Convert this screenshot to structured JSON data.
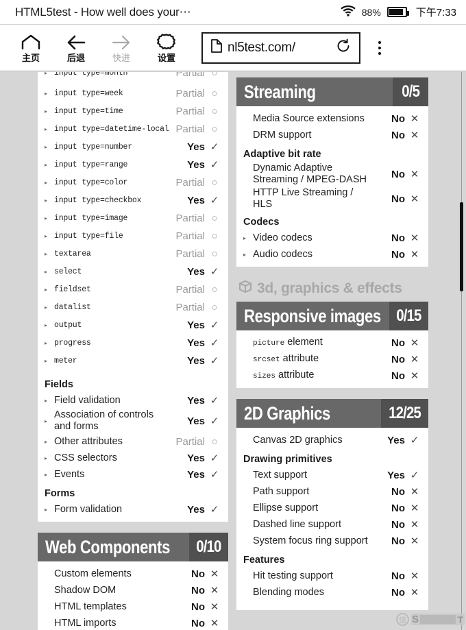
{
  "statusbar": {
    "title": "HTML5test - How well does your⋯",
    "wifi_icon": "wifi-icon",
    "battery_percent": "88%",
    "clock": "下午7:33"
  },
  "toolbar": {
    "home_label": "主页",
    "back_label": "后退",
    "forward_label": "快进",
    "settings_label": "设置",
    "url": "nl5test.com/",
    "reload_icon": "reload-icon",
    "page-icon": "page-icon",
    "menu_icon": "overflow-menu-icon"
  },
  "left_column": {
    "clipped_row": {
      "label": "input type=month",
      "value": "Partial",
      "state": "partial"
    },
    "form_rows": [
      {
        "label": "input type=week",
        "value": "Partial",
        "state": "partial"
      },
      {
        "label": "input type=time",
        "value": "Partial",
        "state": "partial"
      },
      {
        "label": "input type=datetime-local",
        "value": "Partial",
        "state": "partial"
      },
      {
        "label": "input type=number",
        "value": "Yes",
        "state": "yes"
      },
      {
        "label": "input type=range",
        "value": "Yes",
        "state": "yes"
      },
      {
        "label": "input type=color",
        "value": "Partial",
        "state": "partial"
      },
      {
        "label": "input type=checkbox",
        "value": "Yes",
        "state": "yes"
      },
      {
        "label": "input type=image",
        "value": "Partial",
        "state": "partial"
      },
      {
        "label": "input type=file",
        "value": "Partial",
        "state": "partial"
      },
      {
        "label": "textarea",
        "value": "Partial",
        "state": "partial"
      },
      {
        "label": "select",
        "value": "Yes",
        "state": "yes"
      },
      {
        "label": "fieldset",
        "value": "Partial",
        "state": "partial"
      },
      {
        "label": "datalist",
        "value": "Partial",
        "state": "partial"
      },
      {
        "label": "output",
        "value": "Yes",
        "state": "yes"
      },
      {
        "label": "progress",
        "value": "Yes",
        "state": "yes"
      },
      {
        "label": "meter",
        "value": "Yes",
        "state": "yes"
      }
    ],
    "fields_heading": "Fields",
    "fields_rows": [
      {
        "label": "Field validation",
        "value": "Yes",
        "state": "yes"
      },
      {
        "label": "Association of controls and forms",
        "value": "Yes",
        "state": "yes"
      },
      {
        "label": "Other attributes",
        "value": "Partial",
        "state": "partial"
      },
      {
        "label": "CSS selectors",
        "value": "Yes",
        "state": "yes"
      },
      {
        "label": "Events",
        "value": "Yes",
        "state": "yes"
      }
    ],
    "forms_heading": "Forms",
    "forms_rows": [
      {
        "label": "Form validation",
        "value": "Yes",
        "state": "yes"
      }
    ],
    "web_components": {
      "title": "Web Components",
      "score": "0/10",
      "rows": [
        {
          "label": "Custom elements",
          "value": "No",
          "state": "no"
        },
        {
          "label": "Shadow DOM",
          "value": "No",
          "state": "no"
        },
        {
          "label": "HTML templates",
          "value": "No",
          "state": "no"
        },
        {
          "label": "HTML imports",
          "value": "No",
          "state": "no"
        }
      ]
    }
  },
  "right_column": {
    "streaming": {
      "title": "Streaming",
      "score": "0/5",
      "rows": [
        {
          "label": "Media Source extensions",
          "value": "No",
          "state": "no"
        },
        {
          "label": "DRM support",
          "value": "No",
          "state": "no"
        }
      ],
      "adaptive_heading": "Adaptive bit rate",
      "adaptive_rows": [
        {
          "label": "Dynamic Adaptive Streaming / MPEG-DASH",
          "value": "No",
          "state": "no"
        },
        {
          "label": "HTTP Live Streaming / HLS",
          "value": "No",
          "state": "no"
        }
      ],
      "codecs_heading": "Codecs",
      "codec_rows": [
        {
          "label": "Video codecs",
          "value": "No",
          "state": "no"
        },
        {
          "label": "Audio codecs",
          "value": "No",
          "state": "no"
        }
      ]
    },
    "graphics_group": {
      "title": "3d, graphics & effects",
      "icon": "cube-icon"
    },
    "responsive_images": {
      "title": "Responsive images",
      "score": "0/15",
      "rows": [
        {
          "mono": "picture",
          "rest": " element",
          "value": "No",
          "state": "no"
        },
        {
          "mono": "srcset",
          "rest": " attribute",
          "value": "No",
          "state": "no"
        },
        {
          "mono": "sizes",
          "rest": " attribute",
          "value": "No",
          "state": "no"
        }
      ]
    },
    "graphics_2d": {
      "title": "2D Graphics",
      "score": "12/25",
      "rows": [
        {
          "label": "Canvas 2D graphics",
          "value": "Yes",
          "state": "yes"
        }
      ],
      "primitives_heading": "Drawing primitives",
      "primitives_rows": [
        {
          "label": "Text support",
          "value": "Yes",
          "state": "yes"
        },
        {
          "label": "Path support",
          "value": "No",
          "state": "no"
        },
        {
          "label": "Ellipse support",
          "value": "No",
          "state": "no"
        },
        {
          "label": "Dashed line support",
          "value": "No",
          "state": "no"
        },
        {
          "label": "System focus ring support",
          "value": "No",
          "state": "no"
        }
      ],
      "features_heading": "Features",
      "features_rows": [
        {
          "label": "Hit testing support",
          "value": "No",
          "state": "no"
        },
        {
          "label": "Blending modes",
          "value": "No",
          "state": "no"
        }
      ]
    }
  },
  "watermark": {
    "mark": "值",
    "s": "S",
    "t": "T"
  },
  "colors": {
    "page_bg": "#d6d6d6",
    "section_header": "#686868",
    "score_badge": "#505050",
    "card": "#ffffff",
    "partial_text": "#9a9a9a"
  }
}
